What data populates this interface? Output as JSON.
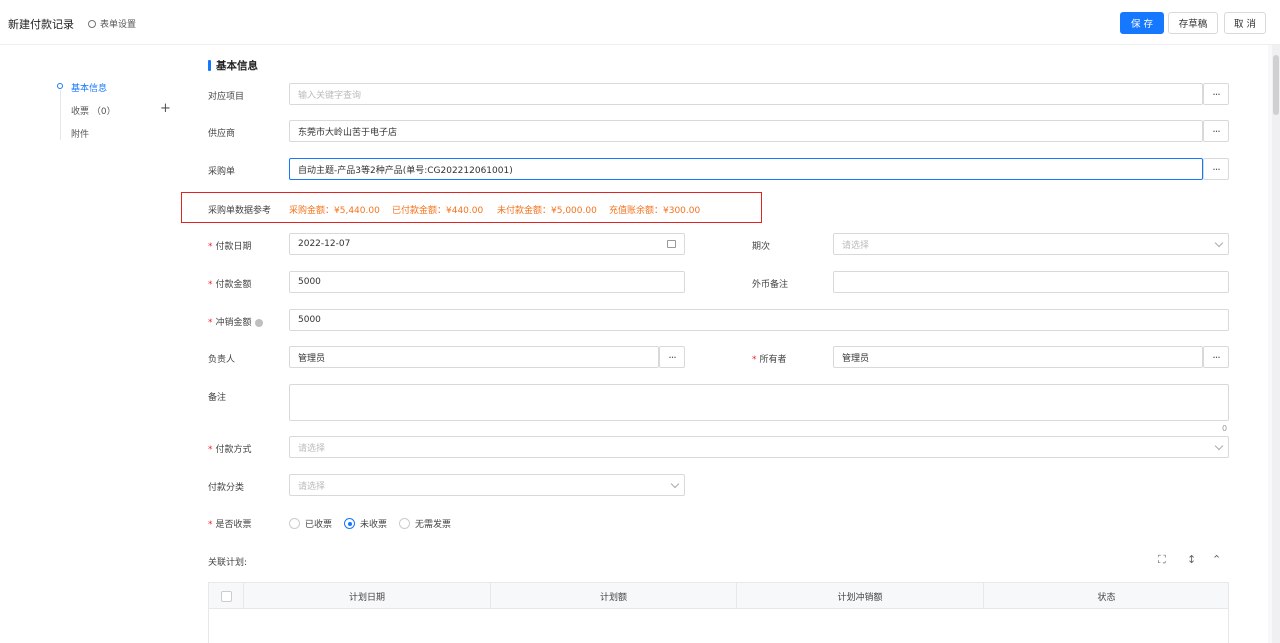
{
  "header": {
    "title": "新建付款记录",
    "form_settings": "表单设置",
    "save": "保 存",
    "draft": "存草稿",
    "cancel": "取 消"
  },
  "nav": {
    "items": [
      {
        "label": "基本信息"
      },
      {
        "label": "收票 （0）"
      },
      {
        "label": "附件"
      }
    ],
    "plus": "+"
  },
  "section": {
    "title": "基本信息"
  },
  "form": {
    "project": {
      "label": "对应项目",
      "placeholder": "输入关键字查询"
    },
    "supplier": {
      "label": "供应商",
      "value": "东莞市大岭山苦于电子店"
    },
    "purchase_order": {
      "label": "采购单",
      "value": "自动主题-产品3等2种产品(单号:CG202212061001)"
    },
    "reference": {
      "label": "采购单数据参考",
      "purchase_amount": "采购金额：¥5,440.00",
      "paid_amount": "已付款金额：¥440.00",
      "unpaid_amount": "未付款金额：¥5,000.00",
      "recharge_balance": "充值账余额：¥300.00"
    },
    "payment_date": {
      "label": "付款日期",
      "value": "2022-12-07"
    },
    "period": {
      "label": "期次",
      "placeholder": "请选择"
    },
    "payment_amount": {
      "label": "付款金额",
      "value": "5000"
    },
    "foreign_note": {
      "label": "外币备注",
      "value": ""
    },
    "offset_amount": {
      "label": "冲销金额",
      "value": "5000"
    },
    "owner_person": {
      "label": "负责人",
      "value": "管理员"
    },
    "owner": {
      "label": "所有者",
      "value": "管理员"
    },
    "remark": {
      "label": "备注",
      "counter": "0"
    },
    "payment_method": {
      "label": "付款方式",
      "placeholder": "请选择"
    },
    "payment_category": {
      "label": "付款分类",
      "placeholder": "请选择"
    },
    "invoice_received": {
      "label": "是否收票",
      "options": [
        "已收票",
        "未收票",
        "无需发票"
      ],
      "selected": "未收票"
    },
    "required_mark": "*",
    "dots": "···"
  },
  "plan": {
    "label": "关联计划:",
    "columns": [
      "计划日期",
      "计划额",
      "计划冲销额",
      "状态"
    ]
  },
  "colors": {
    "accent": "#1677ff",
    "warning": "#f5731d",
    "highlight_box": "#e02424",
    "required": "#f5222d"
  }
}
